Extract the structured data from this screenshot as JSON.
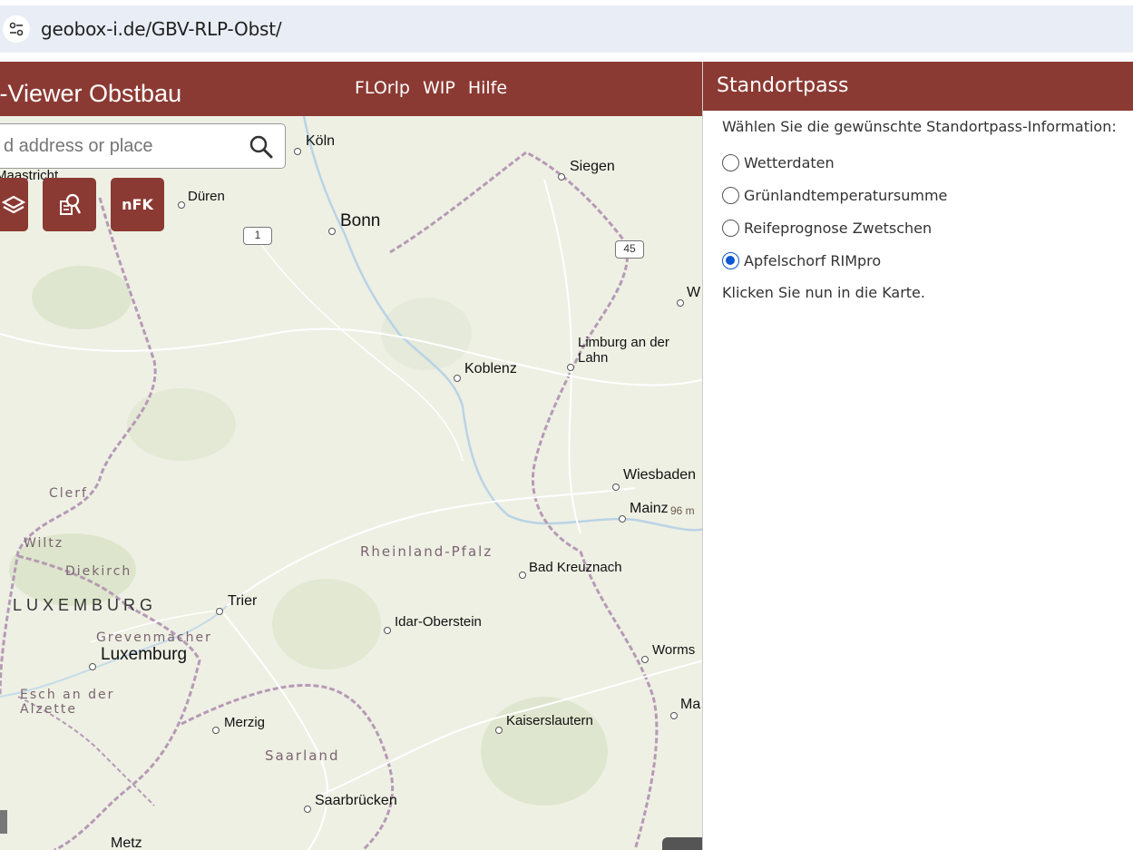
{
  "browser": {
    "url": "geobox-i.de/GBV-RLP-Obst/",
    "site_info_icon": "tune-icon"
  },
  "app": {
    "title": "x-Viewer Obstbau",
    "nav": [
      "FLOrlp",
      "WIP",
      "Hilfe"
    ],
    "header_color": "#8b3a33"
  },
  "search": {
    "placeholder": "d address or place",
    "icon": "search-icon"
  },
  "tools": {
    "layers_icon": "layers-icon",
    "query_icon": "document-search-icon",
    "nfk_label": "nFK"
  },
  "map": {
    "labels": {
      "koeln": "Köln",
      "siegen": "Siegen",
      "maastricht": "Maastricht",
      "dueren": "Düren",
      "bonn": "Bonn",
      "limburg": "Limburg an der Lahn",
      "koblenz": "Koblenz",
      "wiesbaden": "Wiesbaden",
      "mainz": "Mainz",
      "elevation": "96 m",
      "clerf": "Clerf",
      "wiltz": "Wiltz",
      "diekirch": "Diekirch",
      "luxemburg_country": "LUXEMBURG",
      "rheinland_pfalz": "Rheinland-Pfalz",
      "bad_kreuznach": "Bad Kreuznach",
      "trier": "Trier",
      "idar_oberstein": "Idar-Oberstein",
      "grevenmacher": "Grevenmacher",
      "luxemburg_city": "Luxemburg",
      "worms": "Worms",
      "esch": "Esch an der Alzette",
      "merzig": "Merzig",
      "kaiserslautern": "Kaiserslautern",
      "ma": "Ma",
      "w": "W",
      "saarland": "Saarland",
      "saarbruecken": "Saarbrücken",
      "metz": "Metz"
    },
    "shields": [
      "1",
      "45"
    ]
  },
  "panel": {
    "title": "Standortpass",
    "prompt": "Wählen Sie die gewünschte Standortpass-Information:",
    "options": [
      {
        "label": "Wetterdaten",
        "checked": false
      },
      {
        "label": "Grünlandtemperatursumme",
        "checked": false
      },
      {
        "label": "Reifeprognose Zwetschen",
        "checked": false
      },
      {
        "label": "Apfelschorf RIMpro",
        "checked": true
      }
    ],
    "hint": "Klicken Sie nun in die Karte.",
    "radio_color": "#0b57d0"
  }
}
